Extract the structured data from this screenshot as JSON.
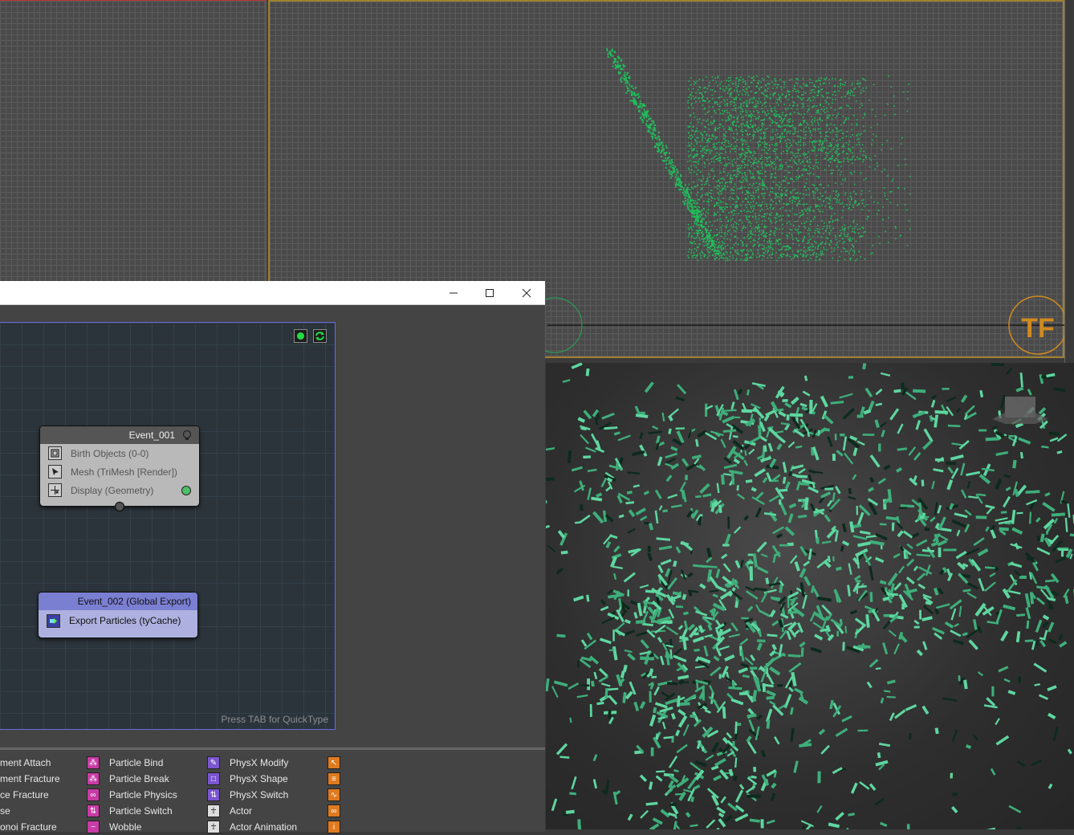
{
  "graph": {
    "hint": "Press TAB for QuickType",
    "nodes": [
      {
        "title": "Event_001",
        "operators": [
          "Birth Objects (0-0)",
          "Mesh (TriMesh [Render])",
          "Display (Geometry)"
        ]
      },
      {
        "title": "Event_002 (Global Export)",
        "operators": [
          "Export Particles (tyCache)"
        ]
      }
    ]
  },
  "tray": {
    "col1": [
      "ment Attach",
      "ment Fracture",
      "ce Fracture",
      "se",
      "onoi Fracture"
    ],
    "col2": [
      "Particle Bind",
      "Particle Break",
      "Particle Physics",
      "Particle Switch",
      "Wobble"
    ],
    "col3": [
      "PhysX Modify",
      "PhysX Shape",
      "PhysX Switch",
      "Actor",
      "Actor Animation"
    ]
  },
  "colors": {
    "particles_top": "#1fbf5a",
    "particles_persp": "#5fd6a0",
    "node_event": "#555555",
    "node_export": "#7b7fd2",
    "graph_border": "#6b6bd8",
    "viewport_active": "#a08030"
  }
}
